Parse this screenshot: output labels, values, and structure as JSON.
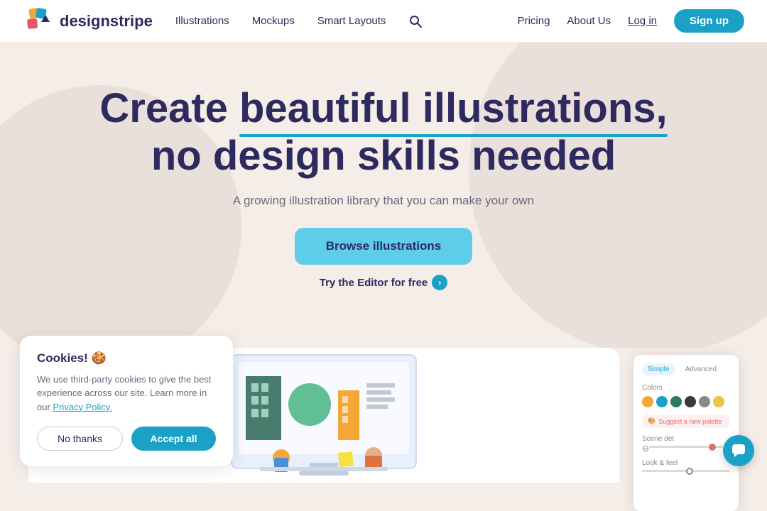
{
  "navbar": {
    "logo_text": "designstripe",
    "nav_items": [
      "Illustrations",
      "Mockups",
      "Smart Layouts"
    ],
    "right_links": [
      "Pricing",
      "About Us",
      "Log in"
    ],
    "signup_label": "Sign up"
  },
  "hero": {
    "headline_part1": "Create ",
    "headline_highlight": "beautiful illustrations,",
    "headline_part2": "no design skills needed",
    "subtitle": "A growing illustration library that you can make your own",
    "browse_btn": "Browse illustrations",
    "editor_btn": "Try the Editor for free"
  },
  "cookies": {
    "title": "Cookies! 🍪",
    "text": "We use third-party cookies to give the best experience across our site. Learn more in our Privacy Policy.",
    "no_thanks": "No thanks",
    "accept_all": "Accept all"
  },
  "editor_panel": {
    "tab_simple": "Simple",
    "tab_advanced": "Advanced",
    "colors_label": "Colors",
    "suggest_label": "Suggest a new palette",
    "scene_label": "Scene det",
    "look_label": "Look & feel",
    "swatches": [
      "#f4a636",
      "#1aa1c8",
      "#2d7a5e",
      "#3a3a3a",
      "#8a8a8a",
      "#e8c840"
    ]
  },
  "chat_btn": "💬"
}
